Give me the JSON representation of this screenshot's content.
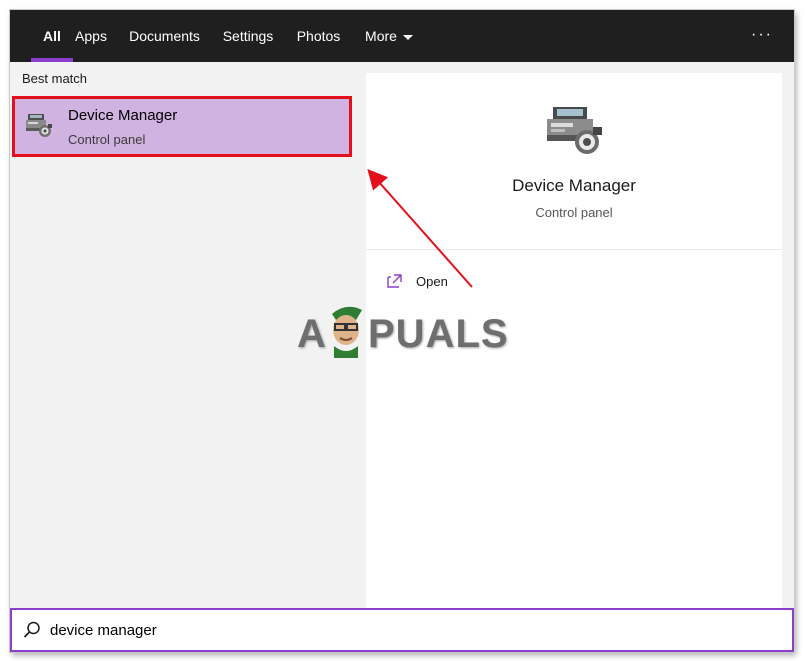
{
  "tabs": [
    {
      "label": "All"
    },
    {
      "label": "Apps"
    },
    {
      "label": "Documents"
    },
    {
      "label": "Settings"
    },
    {
      "label": "Photos"
    },
    {
      "label": "More"
    }
  ],
  "overflow_label": "···",
  "left": {
    "section_label": "Best match",
    "result": {
      "title": "Device Manager",
      "subtitle": "Control panel",
      "icon": "device-manager-icon"
    }
  },
  "detail": {
    "title": "Device Manager",
    "subtitle": "Control panel",
    "icon": "device-manager-icon",
    "actions": [
      {
        "label": "Open",
        "icon": "open-icon"
      }
    ]
  },
  "watermark": {
    "text_left": "A",
    "text_right": "PUALS"
  },
  "search": {
    "value": "device manager",
    "icon": "search-icon"
  },
  "colors": {
    "accent": "#8a3ec9",
    "highlight": "#d1b3e2",
    "annotation_red": "#e3101c",
    "topbar": "#1f1f1f"
  }
}
